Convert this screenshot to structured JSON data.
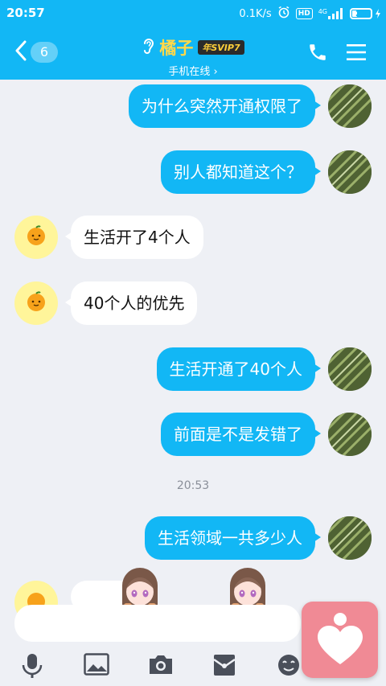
{
  "status_bar": {
    "time": "20:57",
    "net_speed": "0.1K/s",
    "hd_label": "HD",
    "network_label": "4G",
    "battery_level": "24"
  },
  "header": {
    "back_badge": "6",
    "contact_name": "橘子",
    "vip_label": "年SVIP7",
    "online_status": "手机在线 ›"
  },
  "messages": [
    {
      "from": "me",
      "text": "为什么突然开通权限了"
    },
    {
      "from": "me",
      "text": "别人都知道这个？"
    },
    {
      "from": "them",
      "text": "生活开了4个人"
    },
    {
      "from": "them",
      "text": "40个人的优先"
    },
    {
      "from": "me",
      "text": "生活开通了40个人"
    },
    {
      "from": "me",
      "text": "前面是不是发错了"
    },
    {
      "from": "me",
      "text": "生活领域一共多少人"
    }
  ],
  "timestamp": "20:53",
  "toolbar": {
    "icons": [
      "microphone-icon",
      "image-icon",
      "camera-icon",
      "red-packet-icon",
      "emoji-icon"
    ]
  },
  "colors": {
    "brand_blue": "#12b7f5",
    "chat_bg": "#eef0f5",
    "name_yellow": "#ffd84a",
    "floating_pink": "#f08a95"
  }
}
